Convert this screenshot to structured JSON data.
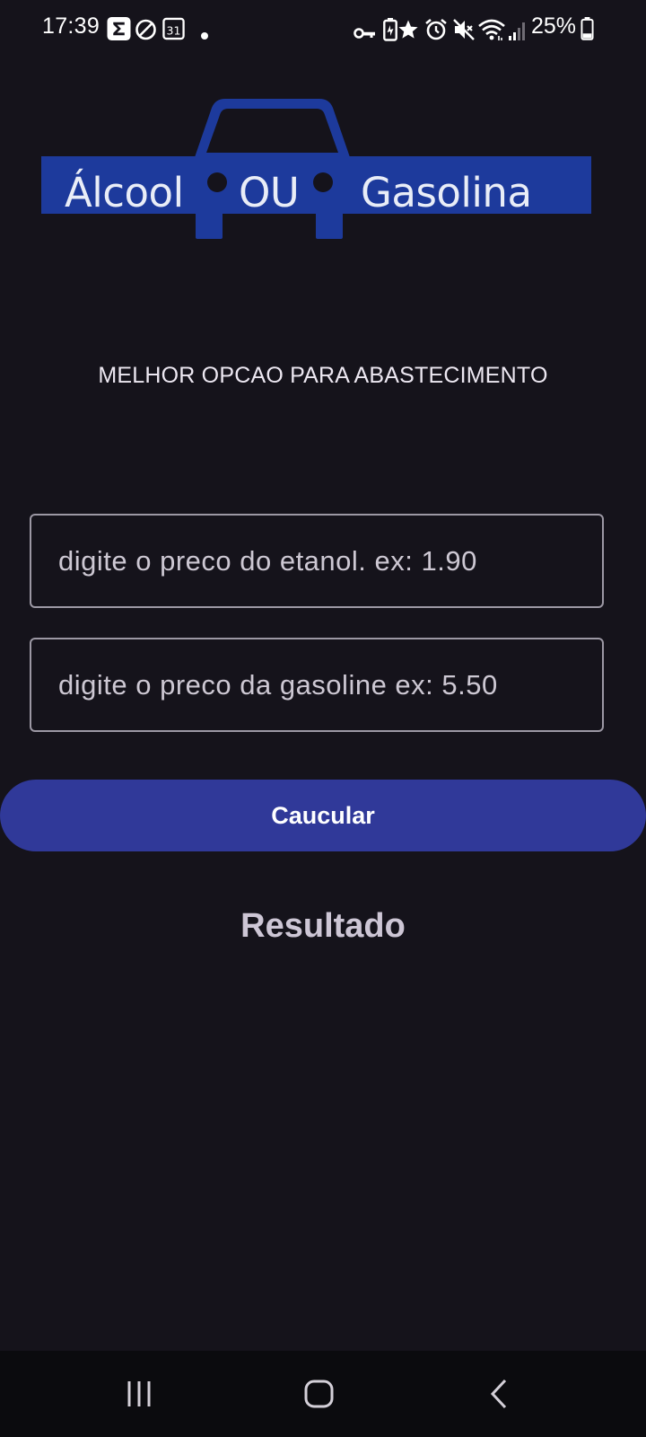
{
  "status_bar": {
    "time": "17:39",
    "battery": "25%",
    "icons": [
      "sigma-icon",
      "do-not-disturb-icon",
      "calendar-icon",
      "notification-dot-icon",
      "vpn-key-icon",
      "battery-saver-icon",
      "star-icon",
      "alarm-icon",
      "mute-icon",
      "wifi-icon",
      "signal-icon",
      "battery-icon"
    ],
    "calendar_day": "31"
  },
  "logo": {
    "word_left": "Álcool",
    "word_middle": "OU",
    "word_right": "Gasolina",
    "color": "#1d3a9c"
  },
  "subtitle": "MELHOR OPCAO PARA ABASTECIMENTO",
  "inputs": {
    "etanol_placeholder": "digite o preco do etanol. ex: 1.90",
    "etanol_value": "",
    "gasoline_placeholder": "digite o preco da gasoline ex: 5.50",
    "gasoline_value": ""
  },
  "button": {
    "label": "Caucular",
    "color": "#303999"
  },
  "result": {
    "label": "Resultado"
  },
  "nav": {
    "icons": [
      "recent-apps-icon",
      "home-icon",
      "back-icon"
    ]
  }
}
